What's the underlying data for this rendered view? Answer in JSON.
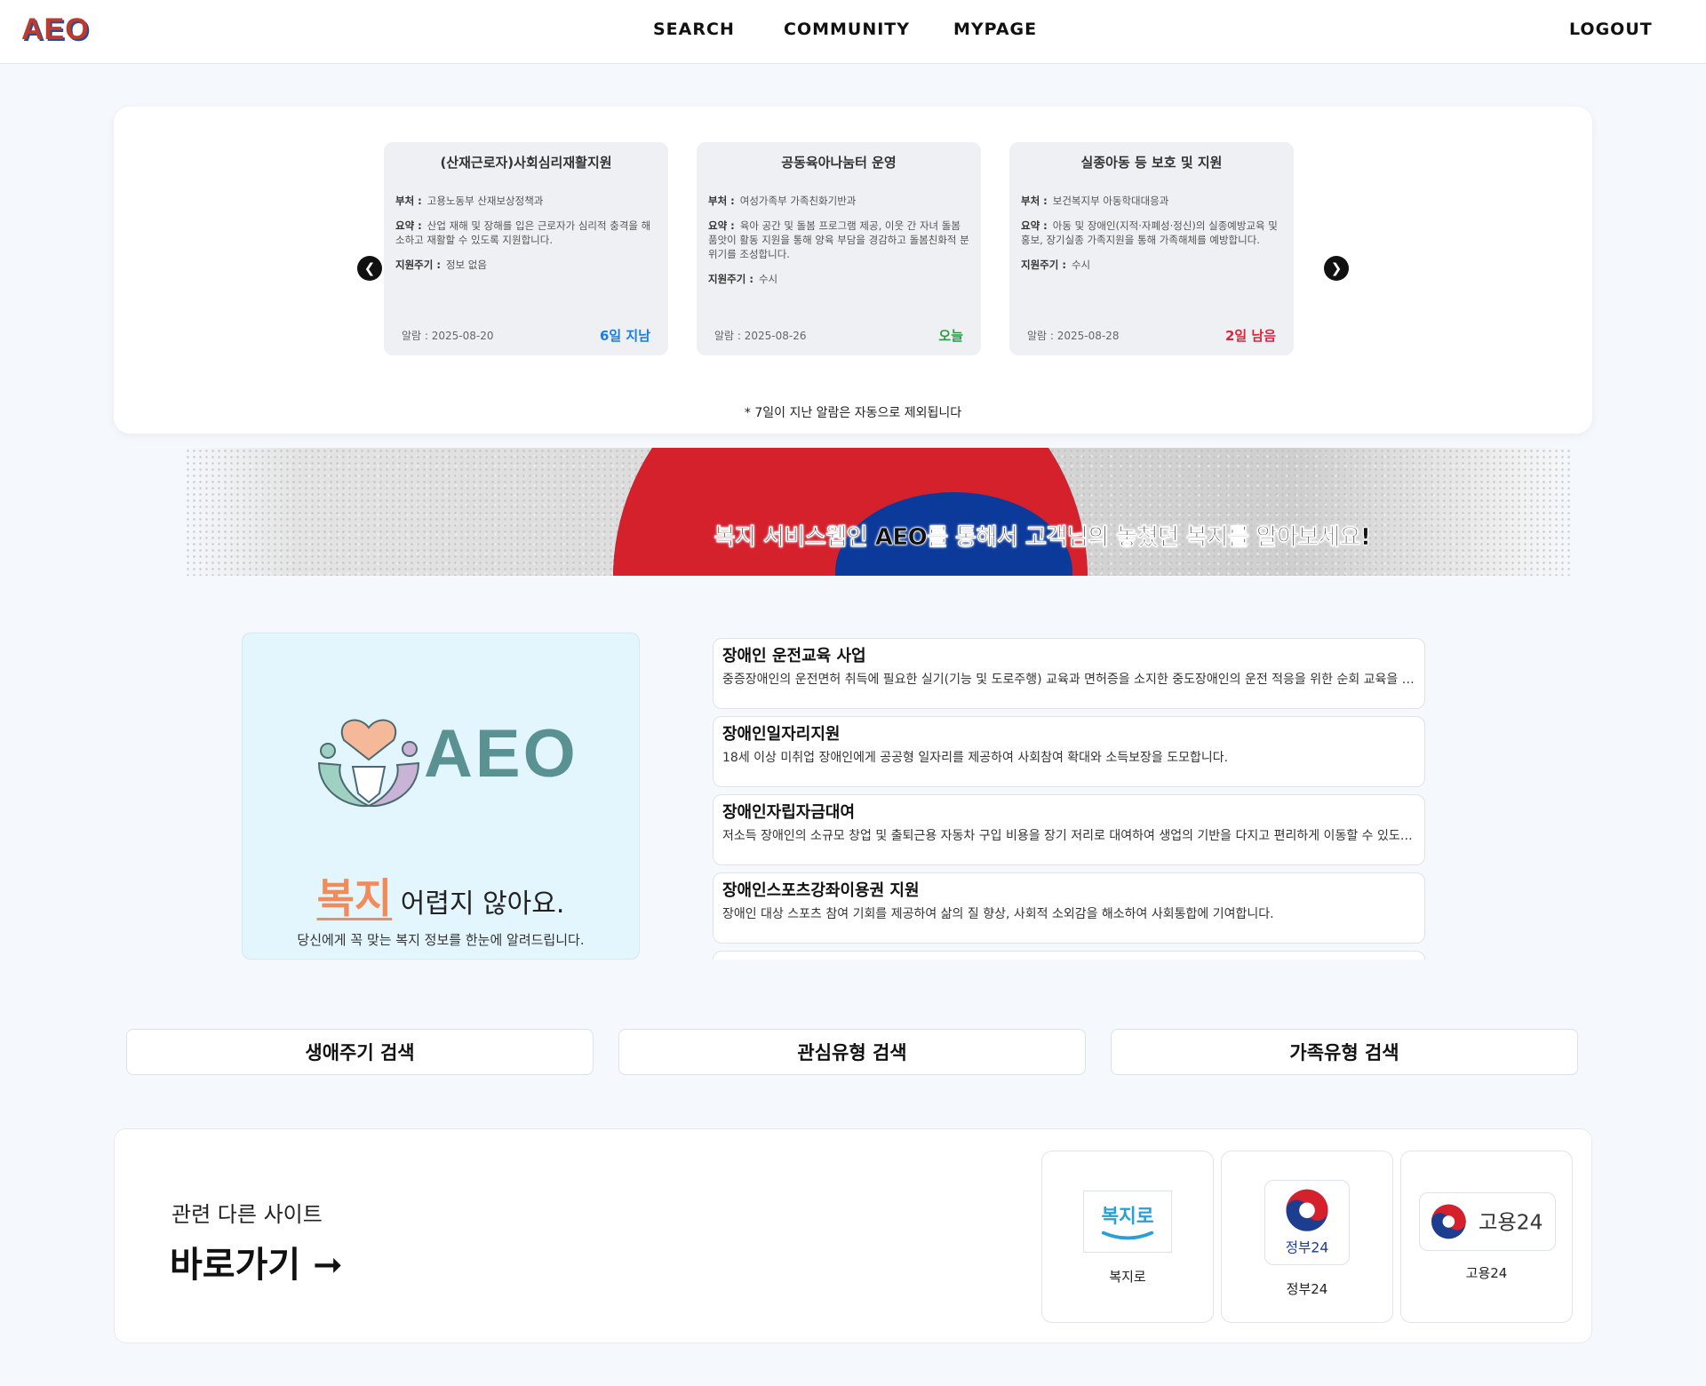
{
  "header": {
    "logo": "AEO",
    "nav": [
      "SEARCH",
      "COMMUNITY",
      "MYPAGE"
    ],
    "logout": "LOGOUT"
  },
  "alerts": {
    "cards": [
      {
        "title": "(산재근로자)사회심리재활지원",
        "dept_label": "부처 :",
        "dept": "고용노동부 산재보상정책과",
        "summary_label": "요약 :",
        "summary": "산업 재해 및 장해를 입은 근로자가 심리적 충격을 해소하고 재활할 수 있도록 지원합니다.",
        "cycle_label": "지원주기 :",
        "cycle": "정보 없음",
        "date": "알람 : 2025-08-20",
        "status": "6일 지남",
        "status_color": "#1a7ee0"
      },
      {
        "title": "공동육아나눔터 운영",
        "dept_label": "부처 :",
        "dept": "여성가족부 가족친화기반과",
        "summary_label": "요약 :",
        "summary": "육아 공간 및 돌봄 프로그램 제공, 이웃 간 자녀 돌봄 품앗이 활동 지원을 통해 양육 부담을 경감하고 돌봄친화적 분위기를 조성합니다.",
        "cycle_label": "지원주기 :",
        "cycle": "수시",
        "date": "알람 : 2025-08-26",
        "status": "오늘",
        "status_color": "#2a9d45"
      },
      {
        "title": "실종아동 등 보호 및 지원",
        "dept_label": "부처 :",
        "dept": "보건복지부 아동학대대응과",
        "summary_label": "요약 :",
        "summary": "아동 및 장애인(지적·자폐성·정신)의 실종예방교육 및 홍보, 장기실종 가족지원을 통해 가족해체를 예방합니다.",
        "cycle_label": "지원주기 :",
        "cycle": "수시",
        "date": "알람 : 2025-08-28",
        "status": "2일 남음",
        "status_color": "#d8263c"
      }
    ],
    "notice": "* 7일이 지난 알람은 자동으로 제외됩니다"
  },
  "banner": {
    "text": "복지 서비스웹인 AEO를 통해서 고객님의 놓쳤던 복지를 알아보세요!"
  },
  "intro": {
    "logo_text": "AEO",
    "headline_accent": "복지",
    "headline_rest": " 어렵지 않아요.",
    "subtitle": "당신에게 꼭 맞는 복지 정보를 한눈에 알려드립니다."
  },
  "welfare_list": [
    {
      "title": "장애인 운전교육 사업",
      "desc": "중증장애인의 운전면허 취득에 필요한 실기(기능 및 도로주행) 교육과 면허증을 소지한 중도장애인의 운전 적응을 위한 순회 교육을 지원합니다."
    },
    {
      "title": "장애인일자리지원",
      "desc": "18세 이상 미취업 장애인에게 공공형 일자리를 제공하여 사회참여 확대와 소득보장을 도모합니다."
    },
    {
      "title": "장애인자립자금대여",
      "desc": "저소득 장애인의 소규모 창업 및 출퇴근용 자동차 구입 비용을 장기 저리로 대여하여 생업의 기반을 다지고 편리하게 이동할 수 있도록 지원합니다."
    },
    {
      "title": "장애인스포츠강좌이용권 지원",
      "desc": "장애인 대상 스포츠 참여 기회를 제공하여 삶의 질 향상, 사회적 소외감을 해소하여 사회통합에 기여합니다."
    },
    {
      "title": "",
      "desc": ""
    }
  ],
  "search_buttons": [
    "생애주기 검색",
    "관심유형 검색",
    "가족유형 검색"
  ],
  "related": {
    "label": "관련 다른 사이트",
    "go": "바로가기 ➞",
    "sites": [
      {
        "name": "복지로",
        "logo_text": "복지로"
      },
      {
        "name": "정부24",
        "logo_text": "정부24"
      },
      {
        "name": "고용24",
        "logo_text": "고용24"
      }
    ]
  },
  "colors": {
    "accent_orange": "#f08c5a",
    "logo_teal": "#5a9294",
    "status_past": "#1a7ee0",
    "status_today": "#2a9d45",
    "status_upcoming": "#d8263c"
  }
}
